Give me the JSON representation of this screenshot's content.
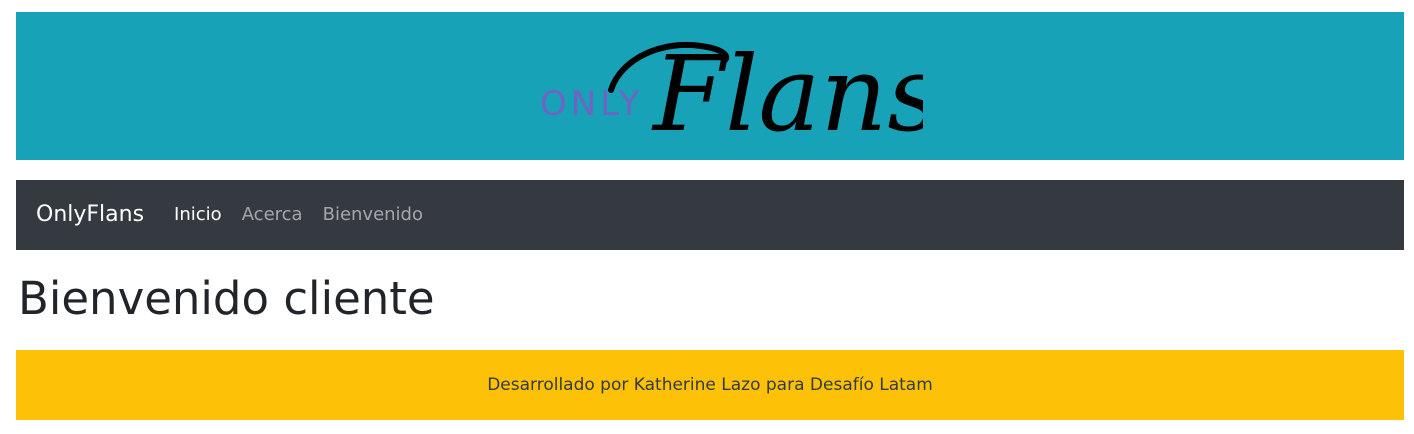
{
  "banner": {
    "logo_prefix": "ONLY",
    "logo_script": "Flans",
    "background_color": "#18a2b8",
    "prefix_color": "#6f63c4"
  },
  "navbar": {
    "brand": "OnlyFlans",
    "items": [
      {
        "label": "Inicio",
        "active": true
      },
      {
        "label": "Acerca",
        "active": false
      },
      {
        "label": "Bienvenido",
        "active": false
      }
    ],
    "background_color": "#343a40"
  },
  "main": {
    "heading": "Bienvenido cliente"
  },
  "footer": {
    "text": "Desarrollado por Katherine Lazo para Desafío Latam",
    "background_color": "#fdc107"
  }
}
